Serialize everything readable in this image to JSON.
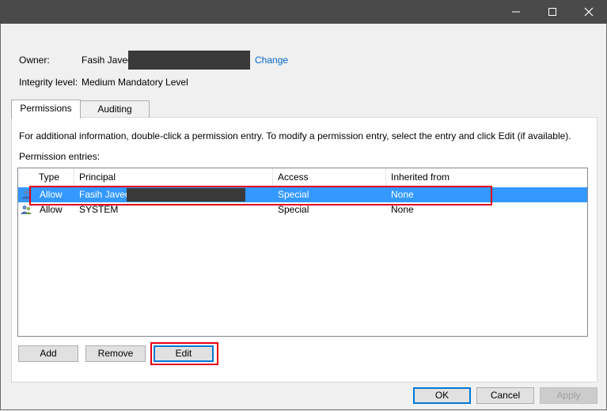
{
  "titlebar": {
    "minimize_glyph": "—",
    "maximize_glyph": "☐",
    "close_glyph": "✕"
  },
  "owner": {
    "label": "Owner:",
    "name": "Fasih Javed",
    "change_link": "Change"
  },
  "integrity": {
    "label": "Integrity level:",
    "value": "Medium Mandatory Level"
  },
  "tabs": [
    {
      "label": "Permissions"
    },
    {
      "label": "Auditing"
    }
  ],
  "info_text": "For additional information, double-click a permission entry. To modify a permission entry, select the entry and click Edit (if available).",
  "entries_label": "Permission entries:",
  "columns": {
    "type": "Type",
    "principal": "Principal",
    "access": "Access",
    "inherited": "Inherited from"
  },
  "rows": [
    {
      "type": "Allow",
      "principal": "Fasih Javed",
      "access": "Special",
      "inherited": "None",
      "selected": true
    },
    {
      "type": "Allow",
      "principal": "SYSTEM",
      "access": "Special",
      "inherited": "None",
      "selected": false
    }
  ],
  "actions": {
    "add": "Add",
    "remove": "Remove",
    "edit": "Edit"
  },
  "footer": {
    "ok": "OK",
    "cancel": "Cancel",
    "apply": "Apply"
  },
  "colors": {
    "selection": "#3399ff",
    "highlight_box": "#e60012",
    "link": "#0066cc",
    "titlebar": "#4a4a4a"
  }
}
